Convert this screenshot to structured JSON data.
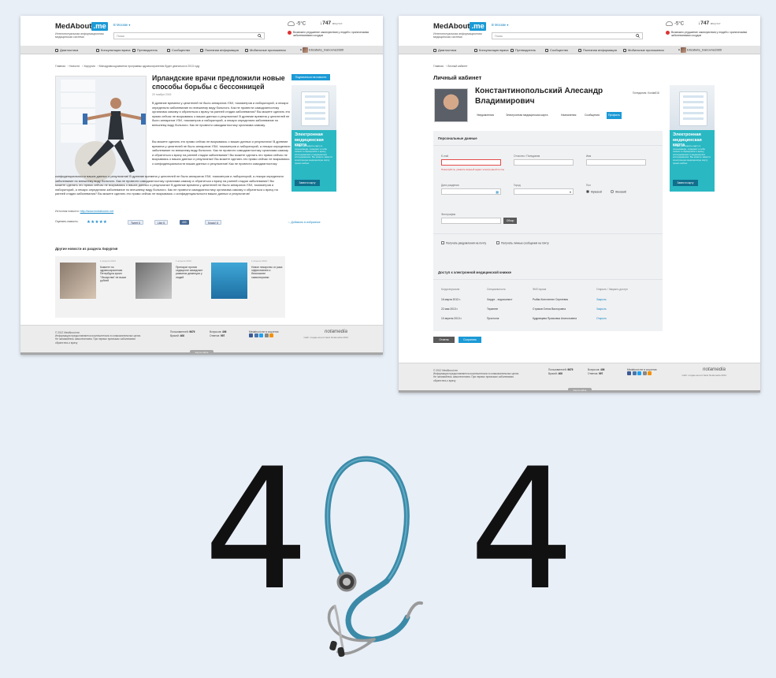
{
  "header": {
    "logo_text": "MedAbout",
    "logo_badge": ".me",
    "tagline": "Интеллектуальная информационная медицинская система",
    "city": "В Москве ▾",
    "search_placeholder": "Поиск",
    "temperature": "-5°C",
    "pressure": "747",
    "pressure_unit": "мм рт.ст",
    "alert": "Возможно ухудшение самочувствия у людей с хроническими заболеваниями сосудов"
  },
  "nav": {
    "items": [
      "Диагностика",
      "Консультации врача",
      "Путеводитель",
      "Сообщество",
      "Полезная информация",
      "Мобильные приложения"
    ],
    "user": "Elizabeta_Ivanovna1989"
  },
  "article": {
    "breadcrumbs": [
      "Главная",
      "Новости",
      "Хирургия",
      "Минздравсоцразвития программы здравоохранения будет двигаться в 2013 году"
    ],
    "title": "Ирландские врачи предложили новые способы борьбы с бессонницей",
    "date": "20 ноября 2015",
    "para1": "В древние времена у целителей не было аппаратов УЗИ, томометров и лабораторий, а лекари определяли заболевание по внешнему виду больного. Как не провести самодиагностику организма самому и обратиться к врачу на ранней стадии заболевания? Вы можете сделать это прямо сейчас не вскрываясь о ваших данных и результатах! В древние времена у целителей не было аппаратов УЗИ, томометров и лабораторий, а лекари определяли заболевание по внешнему виду больного. Как не провести самодиагностику организма самому.",
    "para2": "Вы можете сделать это прямо сейчас не вскрываясь о ваших данных и результатах! В древние времена у целителей не было аппаратов УЗИ, томометров и лабораторий, а лекари определяли заболевание по внешнему виду больного. Как не провести самодиагностику организма самому и обратиться к врачу на ранней стадии заболевания? Вы можете сделать это прямо сейчас не вскрываясь о ваших данных и результатах! Вы можете сделать это прямо сейчас не вскрываясь о конфиденциальности ваших данных и результатов! Как не провести самодиагностику",
    "para3": "конфиденциальности ваших данных и результатов! В древние времена у целителей не было аппаратов УЗИ, томометров и лабораторий, а лекари определяли заболевание по внешнему виду больного. Как не провести самодиагностику организма самому и обратиться к врачу на ранней стадии заболевания? Вы можете сделать это прямо сейчас не вскрываясь о ваших данных и результатах! В древние времена у целителей не было аппаратов УЗИ, томометров и лабораторий, а лекари определяли заболевание по внешнему виду больного. Как не провести самодиагностику организма самому и обратиться к врачу на ранней стадии заболевания? Вы можете сделать это прямо сейчас не вскрываясь о конфиденциальности ваших данных и результатов!",
    "source_label": "Источник новости:",
    "source_link": "http://www.medaboutm.net",
    "rate_label": "Оценить новость:",
    "rating": 3,
    "stars": "★★★★★",
    "share_twitter": "Tweet",
    "share_twitter_count": "6",
    "share_fb": "Like",
    "share_fb_count": "6",
    "share_vk": "Мне нравится",
    "share_vk_count": "400",
    "share_ok": "Класс!",
    "share_ok_count": "6",
    "favorite": "Добавить в избранное",
    "subscribe_button": "Подписаться на новости"
  },
  "promo": {
    "title": "Электронная медицинская карта",
    "text": "Хотите расширить карту в пользовании, содержит в себе записи в обращениях к врачу, исследованиях и медицинских исследованиях. Вы можете завести электронную медицинскую карту прямо сейчас",
    "button": "Завести карту"
  },
  "other_news": {
    "title": "Другие новости из раздела Хирургия",
    "cards": [
      {
        "date": "1 апреля 2012",
        "text": "Комитет по здравоохранению Петербурга купил \"Лекарства\" не выше рублей"
      },
      {
        "date": "1 апреля 2012",
        "text": "Препарат против седационе замедляет развития деменции у людей"
      },
      {
        "date": "1 апреля 2012",
        "text": "Новое лекарство от рака эффективнее и безопаснее химиотерапии"
      }
    ]
  },
  "footer": {
    "copyright": "© 2012 MedAbout.me",
    "disclaimer": "Информация предоставляется исключительно в ознакомительных целях. Не занимайтесь самолечением. При первых признаках заболевания обратитесь к врачу",
    "users_label": "Пользователей:",
    "users_value": "9679",
    "doctors_label": "Врачей:",
    "doctors_value": "406",
    "questions_label": "Вопросов:",
    "questions_value": "406",
    "answers_label": "Ответов:",
    "answers_value": "997",
    "social_label": "Medabout.me в соцсетях:",
    "brand": "notamedia",
    "brand_sub": "Сайт создан агентством Notamedia 2012",
    "map_tab": "Карта сайта"
  },
  "cabinet": {
    "breadcrumbs": [
      "Главная",
      "Личный кабинет"
    ],
    "title": "Личный кабинет",
    "name": "Константинопольский Алесандр Владимирович",
    "login_label": "Псевдоним:",
    "login_value": "Kostia818",
    "tabs": [
      "Уведомления",
      "Электронная медицинская карта",
      "Назначения",
      "Сообщения",
      "Профиль"
    ],
    "active_tab": "Профиль",
    "personal": {
      "title": "Персональные данные",
      "email_label": "E-mail",
      "email_error": "Пожалуйста, укажите верный адрес электронной почты",
      "surname_label": "Отчество / Псевдоним",
      "name_label": "Имя",
      "birth_label": "Дата рождения",
      "city_label": "Город",
      "sex_label": "Пол",
      "sex_male": "Мужской",
      "sex_female": "Женский",
      "photo_label": "Фотография",
      "browse_button": "Обзор",
      "check_notify": "Получать уведомления на почту",
      "check_messages": "Получать личные сообщения на почту"
    },
    "access": {
      "title": "Доступ к электронной медицинской книжке",
      "headers": [
        "Когда впускали",
        "Специальность",
        "ФИО врача",
        "Открыть / Закрыть доступ"
      ],
      "rows": [
        [
          "16 марта 2013 г.",
          "Хирург - эндоскопист",
          "Рыбак Константин Сергеевич",
          "Закрыть"
        ],
        [
          "22 мая 2013 г.",
          "Терапевт",
          "Стриков Олеся Викторовна",
          "Закрыть"
        ],
        [
          "10 апреля 2013 г.",
          "Проктолог",
          "Кудрявцева Прасковья Анатольевна",
          "Открыть"
        ]
      ]
    },
    "cancel_button": "Отмена",
    "save_button": "Сохранить"
  },
  "hero": {
    "digit_left": "4",
    "digit_right": "4"
  },
  "colors": {
    "accent": "#1b9ad6",
    "promo": "#2ab8c3",
    "page_bg": "#e9eff7",
    "stethoscope": "#3b8aa8"
  }
}
